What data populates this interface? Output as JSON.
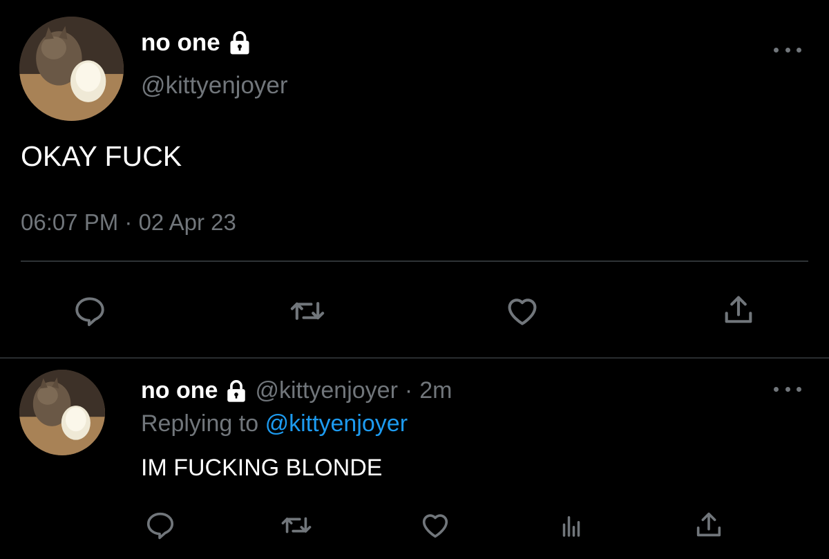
{
  "main_tweet": {
    "display_name": "no one",
    "handle": "@kittyenjoyer",
    "text": "OKAY FUCK",
    "timestamp": "06:07 PM · 02 Apr 23",
    "actions": [
      "reply-icon",
      "retweet-icon",
      "like-icon",
      "share-icon"
    ]
  },
  "reply_tweet": {
    "display_name": "no one",
    "handle": "@kittyenjoyer",
    "separator": "·",
    "age": "2m",
    "replying_prefix": "Replying to",
    "replying_to": "@kittyenjoyer",
    "text": "IM FUCKING BLONDE",
    "actions": [
      "reply-icon",
      "retweet-icon",
      "like-icon",
      "views-icon",
      "share-icon"
    ]
  },
  "colors": {
    "background": "#000000",
    "primary_text": "#ffffff",
    "secondary_text": "#71767b",
    "accent": "#1d9bf0",
    "divider": "#2f3336"
  }
}
